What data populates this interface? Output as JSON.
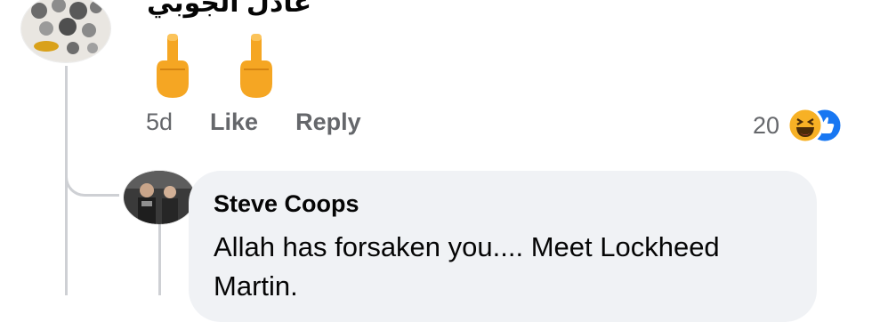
{
  "comment": {
    "author": "عادل الجوبي",
    "content_emojis": [
      "middle-finger-icon",
      "middle-finger-icon"
    ],
    "timestamp": "5d",
    "like_label": "Like",
    "reply_label": "Reply",
    "reaction_count": "20",
    "reaction_icons": [
      "haha-reaction-icon",
      "like-reaction-icon"
    ]
  },
  "reply": {
    "author": "Steve Coops",
    "text": "Allah has forsaken you.... Meet Lockheed Martin."
  },
  "colors": {
    "bubble_bg": "#f0f2f5",
    "muted_text": "#65676b",
    "like_blue": "#1877f2",
    "haha_yellow": "#f7b125",
    "thread_line": "#ced0d4"
  }
}
